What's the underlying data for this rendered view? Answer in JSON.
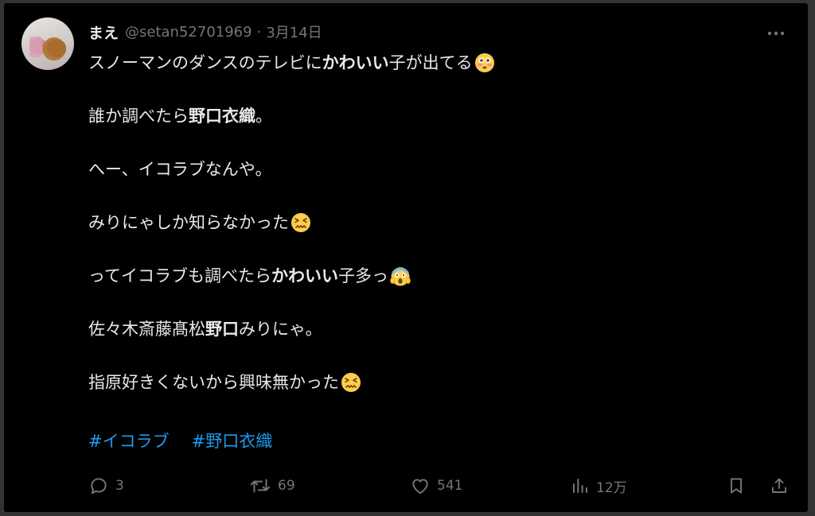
{
  "tweet": {
    "author": {
      "display_name": "まえ",
      "handle": "@setan52701969",
      "separator": "·",
      "date": "3月14日"
    },
    "paragraphs": [
      [
        {
          "t": "スノーマンのダンスのテレビに"
        },
        {
          "t": "かわいい",
          "b": true
        },
        {
          "t": "子が出てる"
        },
        {
          "emoji": "flushed-face-emoji"
        }
      ],
      [
        {
          "t": "誰か調べたら"
        },
        {
          "t": "野口衣織",
          "b": true
        },
        {
          "t": "。"
        }
      ],
      [
        {
          "t": "へー、イコラブなんや。"
        }
      ],
      [
        {
          "t": "みりにゃしか知らなかった"
        },
        {
          "emoji": "confounded-face-emoji"
        }
      ],
      [
        {
          "t": "ってイコラブも調べたら"
        },
        {
          "t": "かわいい",
          "b": true
        },
        {
          "t": "子多っ"
        },
        {
          "emoji": "screaming-face-emoji"
        }
      ],
      [
        {
          "t": "佐々木斎藤髙松"
        },
        {
          "t": "野口",
          "b": true
        },
        {
          "t": "みりにゃ。"
        }
      ],
      [
        {
          "t": "指原好きくないから興味無かった"
        },
        {
          "emoji": "confounded-face-emoji"
        }
      ]
    ],
    "hashtags": [
      "#イコラブ",
      "#野口衣織"
    ],
    "metrics": {
      "replies": "3",
      "reposts": "69",
      "likes": "541",
      "views": "12万"
    }
  },
  "colors": {
    "background": "#000000",
    "text": "#e7e9ea",
    "muted": "#71767b",
    "link": "#1d9bf0"
  }
}
